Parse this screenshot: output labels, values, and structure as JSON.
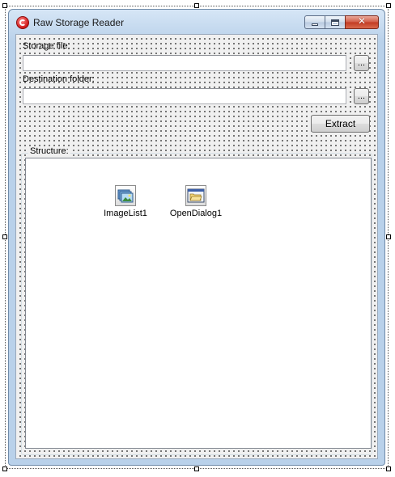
{
  "window": {
    "title": "Raw Storage Reader",
    "icon": "app-logo-icon"
  },
  "form": {
    "storage_file_label": "Storage file:",
    "storage_file_value": "",
    "storage_browse_label": "...",
    "destination_label": "Destination folder:",
    "destination_value": "",
    "destination_browse_label": "...",
    "extract_label": "Extract",
    "structure_label": "Structure:"
  },
  "components": [
    {
      "label": "ImageList1",
      "icon": "image-list-icon"
    },
    {
      "label": "OpenDialog1",
      "icon": "open-dialog-icon"
    }
  ],
  "colors": {
    "window_frame": "#b9d1ea",
    "client_bg": "#f0f0f0",
    "close_button": "#c23b22"
  }
}
